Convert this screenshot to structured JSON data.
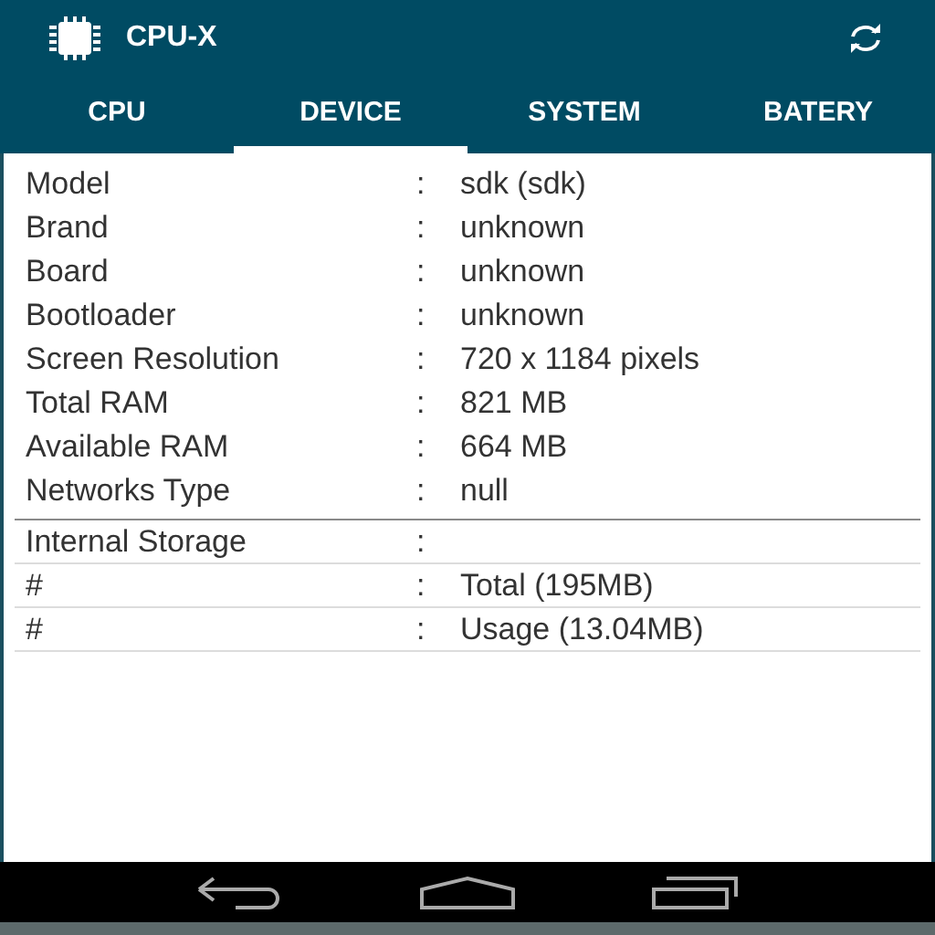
{
  "app_bar": {
    "title": "CPU-X"
  },
  "tabs": [
    {
      "label": "CPU",
      "selected": false
    },
    {
      "label": "DEVICE",
      "selected": true
    },
    {
      "label": "SYSTEM",
      "selected": false
    },
    {
      "label": "BATERY",
      "selected": false
    }
  ],
  "sections": [
    {
      "kind": "plain",
      "rows": [
        {
          "label": "Model",
          "separator": ":",
          "value": "sdk (sdk)"
        },
        {
          "label": "Brand",
          "separator": ":",
          "value": "unknown"
        },
        {
          "label": "Board",
          "separator": ":",
          "value": "unknown"
        },
        {
          "label": "Bootloader",
          "separator": ":",
          "value": "unknown"
        },
        {
          "label": "Screen Resolution",
          "separator": ":",
          "value": "720 x 1184 pixels"
        },
        {
          "label": "Total RAM",
          "separator": ":",
          "value": "821 MB"
        },
        {
          "label": "Available RAM",
          "separator": ":",
          "value": "664 MB"
        },
        {
          "label": "Networks Type",
          "separator": ":",
          "value": "null"
        }
      ]
    },
    {
      "kind": "ruled",
      "rows": [
        {
          "label": "Internal Storage",
          "separator": ":"
        },
        {
          "label": "#",
          "separator": ":",
          "value": "Total (195MB)"
        },
        {
          "label": "#",
          "separator": ":",
          "value": "Usage (13.04MB)"
        }
      ]
    }
  ]
}
